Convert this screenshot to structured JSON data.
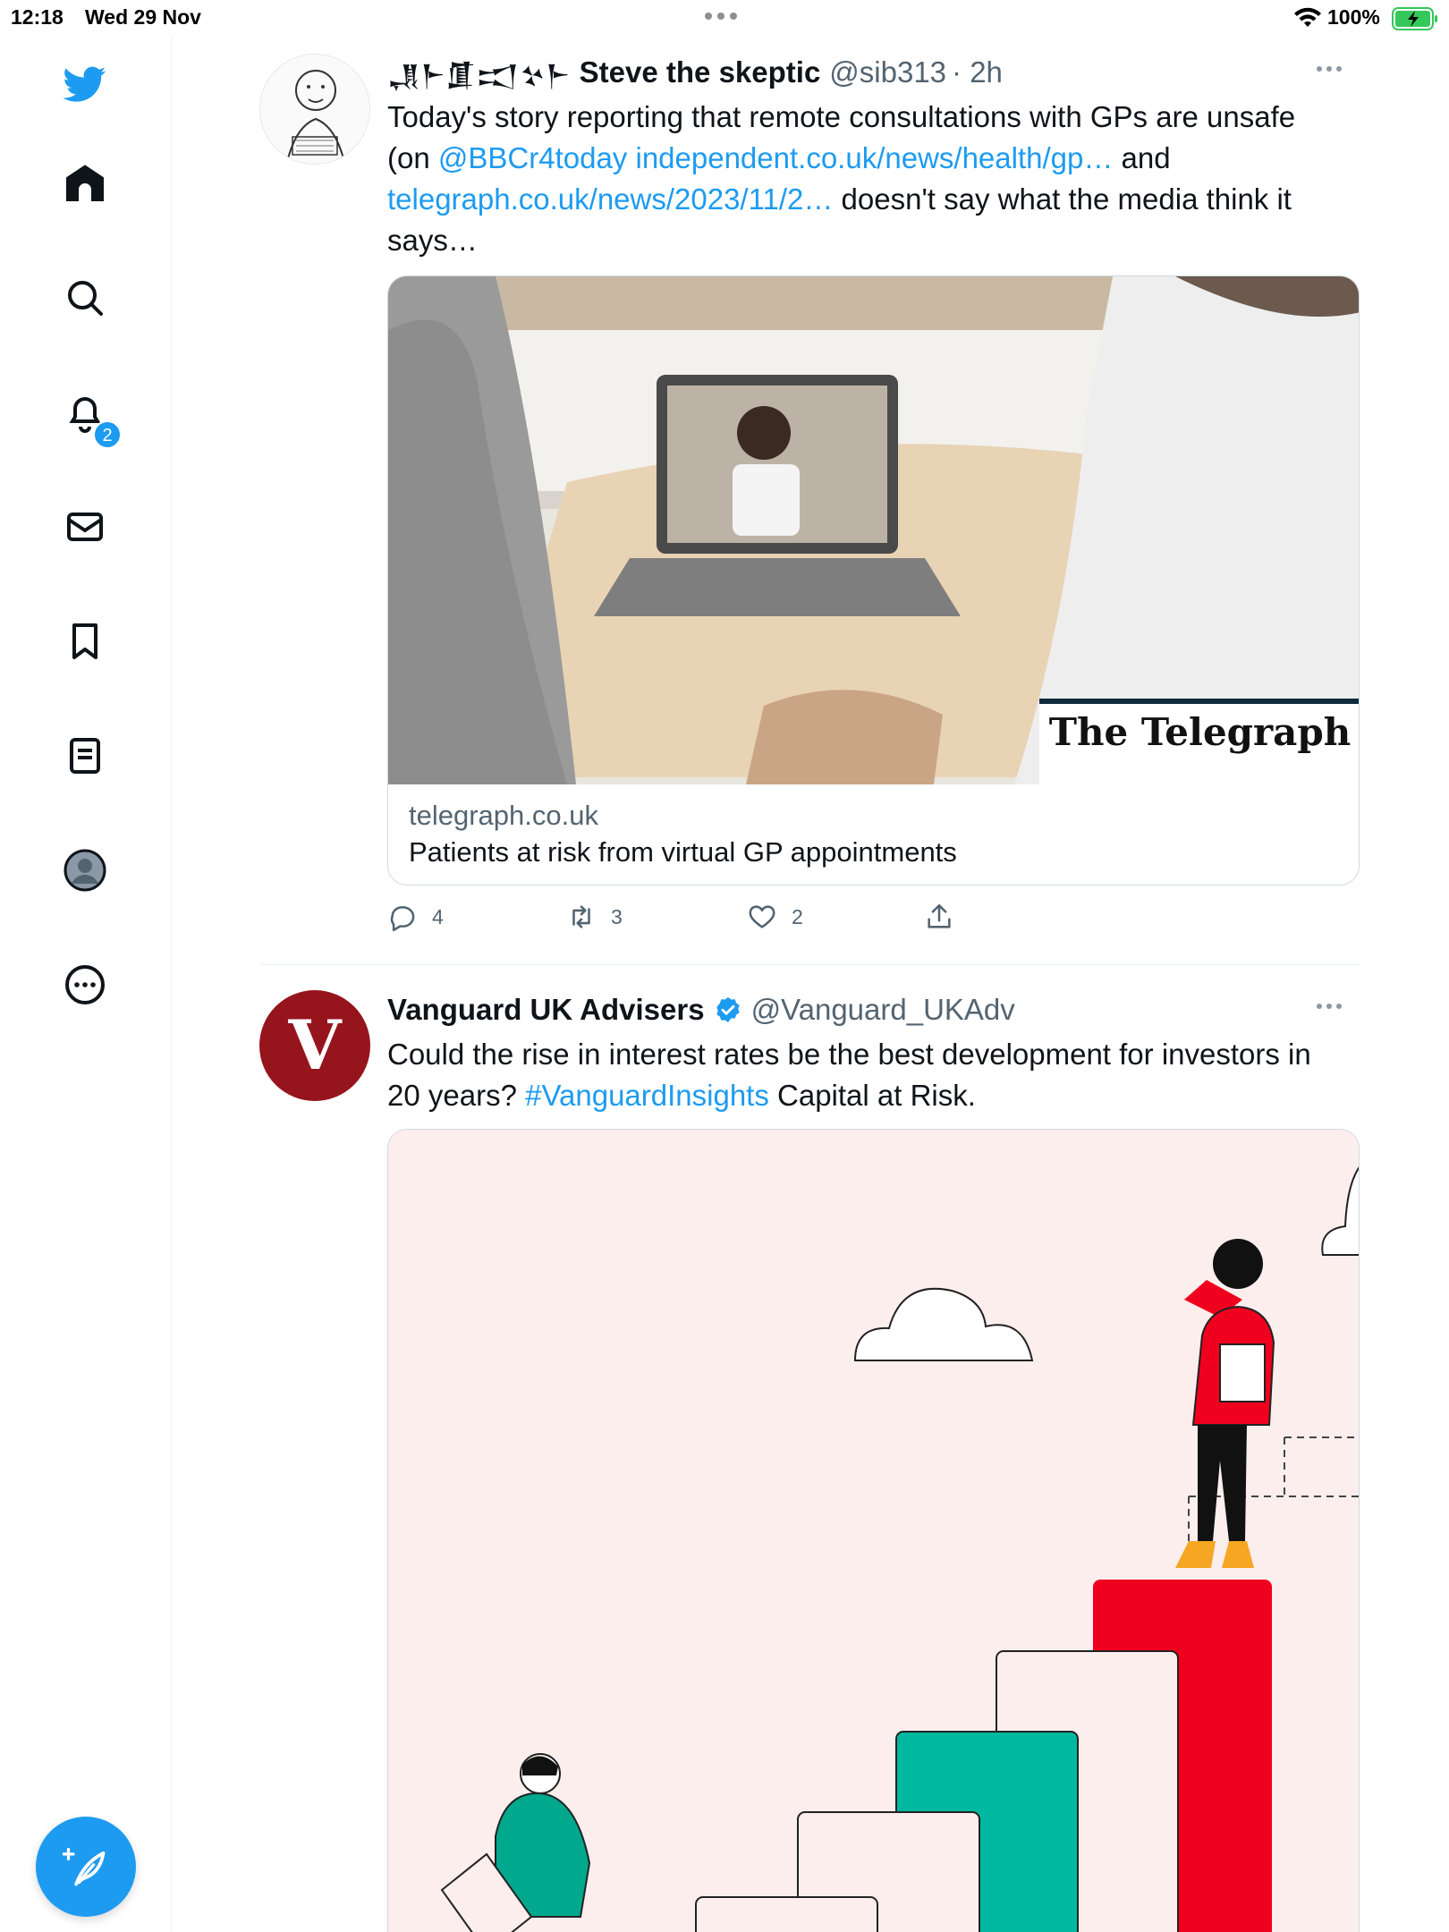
{
  "status_bar": {
    "time": "12:18",
    "date": "Wed 29 Nov",
    "battery": "100%"
  },
  "sidebar": {
    "items": [
      {
        "name": "twitter-logo-icon"
      },
      {
        "name": "home-icon"
      },
      {
        "name": "search-icon"
      },
      {
        "name": "notifications-icon",
        "badge": "2"
      },
      {
        "name": "messages-icon"
      },
      {
        "name": "bookmarks-icon"
      },
      {
        "name": "lists-icon"
      },
      {
        "name": "profile-icon"
      },
      {
        "name": "more-icon"
      }
    ],
    "notification_badge": "2",
    "compose_icon": "compose-tweet-icon"
  },
  "tweets": [
    {
      "name_glyphs": "𒂗𒈨𒂠𒀊𒆳𒈨",
      "display_name": "Steve the skeptic",
      "handle": "@sib313",
      "time": "· 2h",
      "text": {
        "t1": "Today's story reporting that remote consultations with GPs are unsafe",
        "t2": "(on ",
        "mention": "@BBCr4today",
        "link1": "independent.co.uk/news/health/gp…",
        "t3": " and",
        "link2": "telegraph.co.uk/news/2023/11/2…",
        "t4": " doesn't say what the media think it",
        "t5": "says…"
      },
      "card": {
        "image_brand": "The Telegraph",
        "domain": "telegraph.co.uk",
        "title": "Patients at risk from virtual GP appointments"
      },
      "actions": {
        "replies": "4",
        "retweets": "3",
        "likes": "2"
      }
    },
    {
      "display_name": "Vanguard UK Advisers",
      "verified": true,
      "handle": "@Vanguard_UKAdv",
      "avatar_letter": "V",
      "text": {
        "t1": "Could the rise in interest rates be the best development for investors in",
        "t2": "20 years? ",
        "hashtag": "#VanguardInsights",
        "t3": " Capital at Risk."
      },
      "media": {
        "background": "#fdeeee"
      }
    }
  ],
  "colors": {
    "accent": "#1d9bf0",
    "text": "#0f1419",
    "muted": "#536471",
    "vanguard": "#96151d"
  }
}
